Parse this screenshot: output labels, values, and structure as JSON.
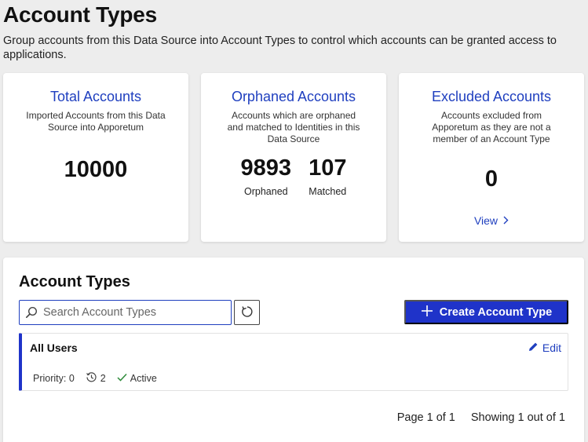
{
  "page": {
    "title": "Account Types",
    "description": "Group accounts from this Data Source into Account Types to control which accounts can be granted access to applications."
  },
  "cards": {
    "total": {
      "title": "Total Accounts",
      "subtitle": "Imported Accounts from this Data Source into Apporetum",
      "value": "10000"
    },
    "orphaned": {
      "title": "Orphaned Accounts",
      "subtitle": "Accounts which are orphaned and matched to Identities in this Data Source",
      "orphaned_value": "9893",
      "orphaned_label": "Orphaned",
      "matched_value": "107",
      "matched_label": "Matched"
    },
    "excluded": {
      "title": "Excluded Accounts",
      "subtitle": "Accounts excluded from Apporetum as they are not a member of an Account Type",
      "value": "0",
      "view_label": "View"
    }
  },
  "panel": {
    "title": "Account Types",
    "search_placeholder": "Search Account Types",
    "search_value": "",
    "create_label": "Create Account Type",
    "rows": [
      {
        "name": "All Users",
        "edit_label": "Edit",
        "priority": "Priority: 0",
        "history_count": "2",
        "status": "Active"
      }
    ],
    "pagination": {
      "page": "Page 1 of 1",
      "showing": "Showing 1 out of 1"
    }
  },
  "colors": {
    "accent": "#1f33c9",
    "link": "#1f3fbf",
    "background": "#ededed",
    "active_check": "#2e8b3a"
  },
  "icons": [
    "search-icon",
    "refresh-icon",
    "plus-icon",
    "pencil-icon",
    "chevron-right-icon",
    "history-icon",
    "check-icon"
  ]
}
